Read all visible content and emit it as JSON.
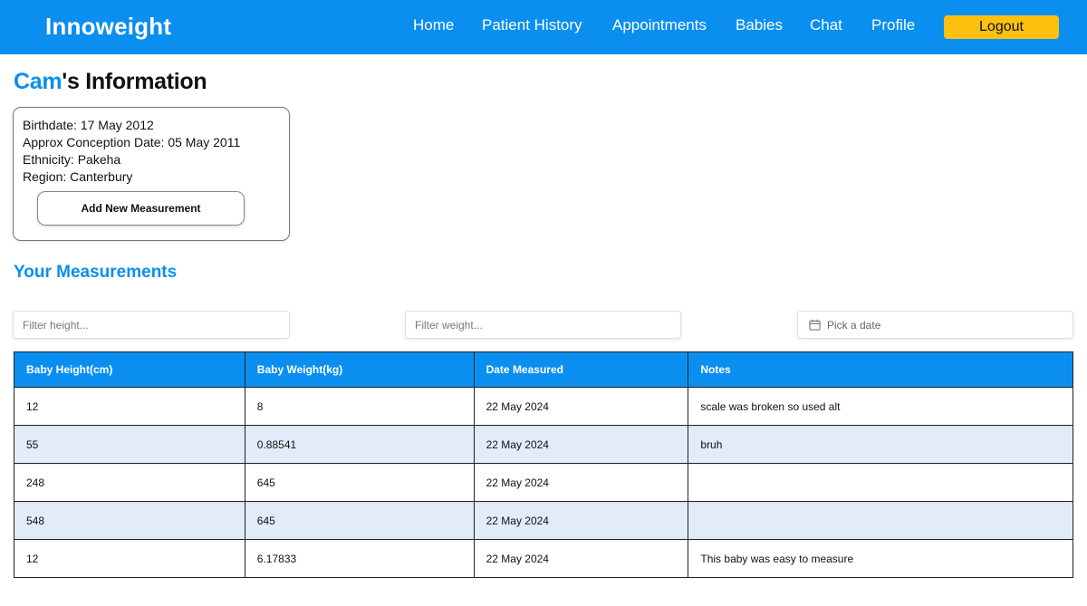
{
  "header": {
    "brand": "Innoweight",
    "nav": [
      "Home",
      "Patient History",
      "Appointments",
      "Babies",
      "Chat",
      "Profile"
    ],
    "logout_label": "Logout",
    "colors": {
      "bar": "#0a8ff0",
      "logout": "#fcc10f"
    }
  },
  "baby": {
    "name": "Cam",
    "title_suffix": "'s Information",
    "info": [
      {
        "label": "Birthdate: ",
        "value": "17 May 2012"
      },
      {
        "label": "Approx Conception Date: ",
        "value": "05 May 2011"
      },
      {
        "label": "Ethnicity: ",
        "value": "Pakeha"
      },
      {
        "label": "Region: ",
        "value": "Canterbury"
      }
    ],
    "add_button": "Add New Measurement"
  },
  "measurements": {
    "title": "Your Measurements",
    "filters": {
      "height_placeholder": "Filter height...",
      "weight_placeholder": "Filter weight...",
      "date_placeholder": "Pick a date",
      "date_icon": "calendar-icon"
    },
    "columns": [
      "Baby Height(cm)",
      "Baby Weight(kg)",
      "Date Measured",
      "Notes"
    ],
    "rows": [
      [
        "12",
        "8",
        "22 May 2024",
        "scale was broken so used alt"
      ],
      [
        "55",
        "0.88541",
        "22 May 2024",
        "bruh"
      ],
      [
        "248",
        "645",
        "22 May 2024",
        ""
      ],
      [
        "548",
        "645",
        "22 May 2024",
        ""
      ],
      [
        "12",
        "6.17833",
        "22 May 2024",
        "This baby was easy to measure"
      ]
    ]
  }
}
